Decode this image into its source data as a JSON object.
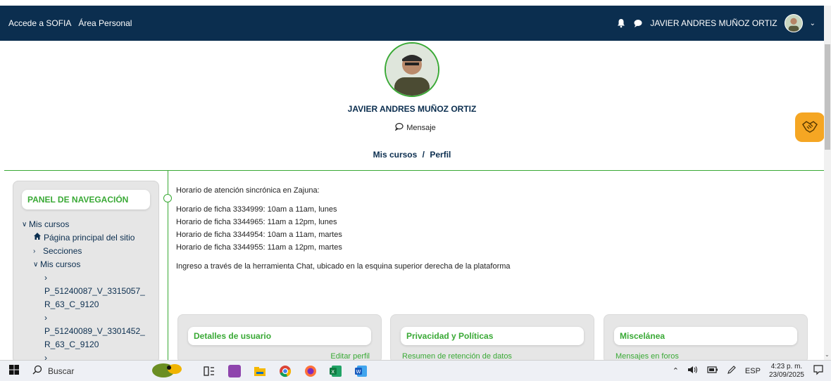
{
  "navbar": {
    "link_sofia": "Accede a SOFIA",
    "link_area": "Área Personal",
    "user_name": "JAVIER ANDRES MUÑOZ ORTIZ"
  },
  "profile": {
    "name": "JAVIER ANDRES MUÑOZ ORTIZ",
    "message_label": "Mensaje",
    "breadcrumb_1": "Mis cursos",
    "breadcrumb_sep": "/",
    "breadcrumb_2": "Perfil"
  },
  "nav_panel": {
    "title": "PANEL DE NAVEGACIÓN",
    "items": [
      {
        "label": "Mis cursos"
      },
      {
        "label": "Página principal del sitio"
      },
      {
        "label": "Secciones"
      },
      {
        "label": "Mis cursos"
      },
      {
        "label": "P_51240087_V_3315057_R_63_C_9120"
      },
      {
        "label": "P_51240089_V_3301452_R_63_C_9120"
      }
    ]
  },
  "main": {
    "intro": "Horario de atención sincrónica en Zajuna:",
    "schedules": [
      "Horario de ficha 3334999: 10am a 11am, lunes",
      "Horario de ficha 3344965: 11am a 12pm, lunes",
      "Horario de ficha 3344954: 10am a 11am, martes",
      "Horario de ficha 3344955: 11am a 12pm, martes"
    ],
    "chat_note": "Ingreso a través de la herramienta Chat, ubicado en la esquina superior derecha de la plataforma"
  },
  "cards": [
    {
      "title": "Detalles de usuario",
      "link": "Editar perfil"
    },
    {
      "title": "Privacidad y Políticas",
      "link": "Resumen de retención de datos"
    },
    {
      "title": "Miscelánea",
      "link": "Mensajes en foros"
    }
  ],
  "taskbar": {
    "search_label": "Buscar",
    "lang": "ESP",
    "time": "4:23 p. m.",
    "date": "23/09/2025"
  },
  "colors": {
    "navbar": "#0b2e4f",
    "accent_green": "#39a935",
    "handshake_orange": "#f5a623"
  }
}
